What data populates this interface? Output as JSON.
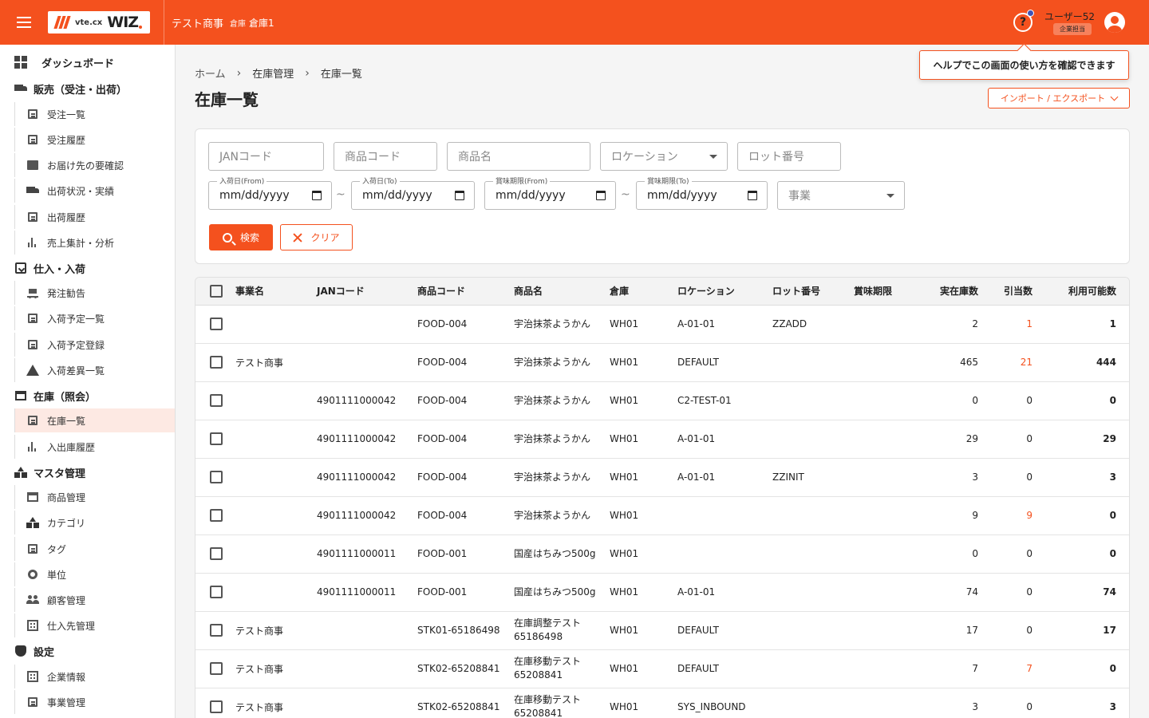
{
  "header": {
    "logo_small": "vte.cx",
    "logo_big": "WIZ",
    "company": "テスト商事",
    "warehouse_label": "倉庫",
    "warehouse": "倉庫1",
    "help_glyph": "?",
    "user_name": "ユーザー52",
    "user_role": "企業担当"
  },
  "tooltip": "ヘルプでこの画面の使い方を確認できます",
  "sidebar": {
    "dashboard": "ダッシュボード",
    "sales": "販売（受注・出荷）",
    "sales_items": [
      "受注一覧",
      "受注履歴",
      "お届け先の要確認",
      "出荷状況・実績",
      "出荷履歴",
      "売上集計・分析"
    ],
    "purchase": "仕入・入荷",
    "purchase_items": [
      "発注勧告",
      "入荷予定一覧",
      "入荷予定登録",
      "入荷差異一覧"
    ],
    "stock": "在庫（照会）",
    "stock_items": [
      "在庫一覧",
      "入出庫履歴"
    ],
    "master": "マスタ管理",
    "master_items": [
      "商品管理",
      "カテゴリ",
      "タグ",
      "単位",
      "顧客管理",
      "仕入先管理"
    ],
    "settings": "設定",
    "settings_items": [
      "企業情報",
      "事業管理"
    ]
  },
  "breadcrumb": {
    "home": "ホーム",
    "stock": "在庫管理",
    "current": "在庫一覧",
    "sep": "›"
  },
  "page_title": "在庫一覧",
  "import_export": "インポート / エクスポート",
  "search": {
    "jan": "JANコード",
    "product_code": "商品コード",
    "product_name": "商品名",
    "location": "ロケーション",
    "lot": "ロット番号",
    "in_from_label": "入荷日(From)",
    "in_to_label": "入荷日(To)",
    "exp_from_label": "賞味期限(From)",
    "exp_to_label": "賞味期限(To)",
    "date_placeholder": "mm/dd/yyyy",
    "tilde": "~",
    "business": "事業",
    "search_btn": "検索",
    "clear_btn": "クリア"
  },
  "table": {
    "headers": [
      "事業名",
      "JANコード",
      "商品コード",
      "商品名",
      "倉庫",
      "ロケーション",
      "ロット番号",
      "賞味期限",
      "実在庫数",
      "引当数",
      "利用可能数"
    ],
    "rows": [
      {
        "business": "",
        "jan": "",
        "code": "FOOD-004",
        "name": "宇治抹茶ようかん",
        "wh": "WH01",
        "loc": "A-01-01",
        "lot": "ZZADD",
        "exp": "",
        "stock": "2",
        "alloc": "1",
        "avail": "1",
        "alloc_hi": true
      },
      {
        "business": "テスト商事",
        "jan": "",
        "code": "FOOD-004",
        "name": "宇治抹茶ようかん",
        "wh": "WH01",
        "loc": "DEFAULT",
        "lot": "",
        "exp": "",
        "stock": "465",
        "alloc": "21",
        "avail": "444",
        "alloc_hi": true
      },
      {
        "business": "",
        "jan": "4901111000042",
        "code": "FOOD-004",
        "name": "宇治抹茶ようかん",
        "wh": "WH01",
        "loc": "C2-TEST-01",
        "lot": "",
        "exp": "",
        "stock": "0",
        "alloc": "0",
        "avail": "0",
        "alloc_hi": false
      },
      {
        "business": "",
        "jan": "4901111000042",
        "code": "FOOD-004",
        "name": "宇治抹茶ようかん",
        "wh": "WH01",
        "loc": "A-01-01",
        "lot": "",
        "exp": "",
        "stock": "29",
        "alloc": "0",
        "avail": "29",
        "alloc_hi": false
      },
      {
        "business": "",
        "jan": "4901111000042",
        "code": "FOOD-004",
        "name": "宇治抹茶ようかん",
        "wh": "WH01",
        "loc": "A-01-01",
        "lot": "ZZINIT",
        "exp": "",
        "stock": "3",
        "alloc": "0",
        "avail": "3",
        "alloc_hi": false
      },
      {
        "business": "",
        "jan": "4901111000042",
        "code": "FOOD-004",
        "name": "宇治抹茶ようかん",
        "wh": "WH01",
        "loc": "",
        "lot": "",
        "exp": "",
        "stock": "9",
        "alloc": "9",
        "avail": "0",
        "alloc_hi": true
      },
      {
        "business": "",
        "jan": "4901111000011",
        "code": "FOOD-001",
        "name": "国産はちみつ500g",
        "wh": "WH01",
        "loc": "",
        "lot": "",
        "exp": "",
        "stock": "0",
        "alloc": "0",
        "avail": "0",
        "alloc_hi": false
      },
      {
        "business": "",
        "jan": "4901111000011",
        "code": "FOOD-001",
        "name": "国産はちみつ500g",
        "wh": "WH01",
        "loc": "A-01-01",
        "lot": "",
        "exp": "",
        "stock": "74",
        "alloc": "0",
        "avail": "74",
        "alloc_hi": false
      },
      {
        "business": "テスト商事",
        "jan": "",
        "code": "STK01-65186498",
        "name": "在庫調整テスト65186498",
        "wh": "WH01",
        "loc": "DEFAULT",
        "lot": "",
        "exp": "",
        "stock": "17",
        "alloc": "0",
        "avail": "17",
        "alloc_hi": false
      },
      {
        "business": "テスト商事",
        "jan": "",
        "code": "STK02-65208841",
        "name": "在庫移動テスト65208841",
        "wh": "WH01",
        "loc": "DEFAULT",
        "lot": "",
        "exp": "",
        "stock": "7",
        "alloc": "7",
        "avail": "0",
        "alloc_hi": true
      },
      {
        "business": "テスト商事",
        "jan": "",
        "code": "STK02-65208841",
        "name": "在庫移動テスト65208841",
        "wh": "WH01",
        "loc": "SYS_INBOUND",
        "lot": "",
        "exp": "",
        "stock": "3",
        "alloc": "0",
        "avail": "3",
        "alloc_hi": false
      }
    ]
  },
  "colors": {
    "accent": "#f4511e",
    "active_bg": "#fde9e3"
  }
}
